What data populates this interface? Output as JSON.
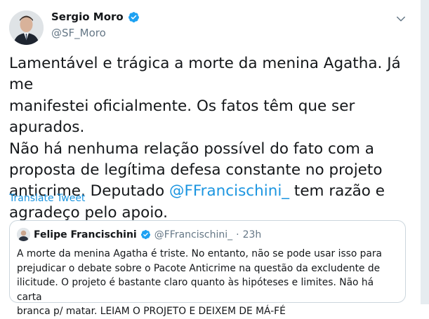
{
  "tweet": {
    "author": {
      "name": "Sergio Moro",
      "handle": "@SF_Moro"
    },
    "text_before_mention": "Lamentável e trágica a morte da menina Agatha. Já me\nmanifestei oficialmente. Os fatos têm que ser apurados.\nNão há nenhuma relação possível do fato com a\nproposta de legítima defesa constante no projeto\nanticrime. Deputado ",
    "mention": "@FFrancischini_",
    "text_after_mention": "  tem razão e\nagradeço pelo apoio.",
    "translate_label": "Translate Tweet"
  },
  "quoted_tweet": {
    "author_name": "Felipe Francischini",
    "author_handle": "@FFrancischini_",
    "separator": "·",
    "time": "23h",
    "text": "A morte da menina Agatha é triste. No entanto, não se pode usar isso para\nprejudicar o debate sobre o Pacote Anticrime na questão da excludente de\nilicitude. O projeto é bastante claro quanto às hipóteses e limites. Não há carta\nbranca p/ matar. LEIAM O PROJETO E DEIXEM DE MÁ-FÉ"
  },
  "icons": {
    "verified": "verified-badge-icon",
    "menu": "chevron-down-icon"
  },
  "colors": {
    "link": "#1b95e0",
    "verified": "#1da1f2",
    "secondary_text": "#657786",
    "border": "#ccd6dd"
  }
}
